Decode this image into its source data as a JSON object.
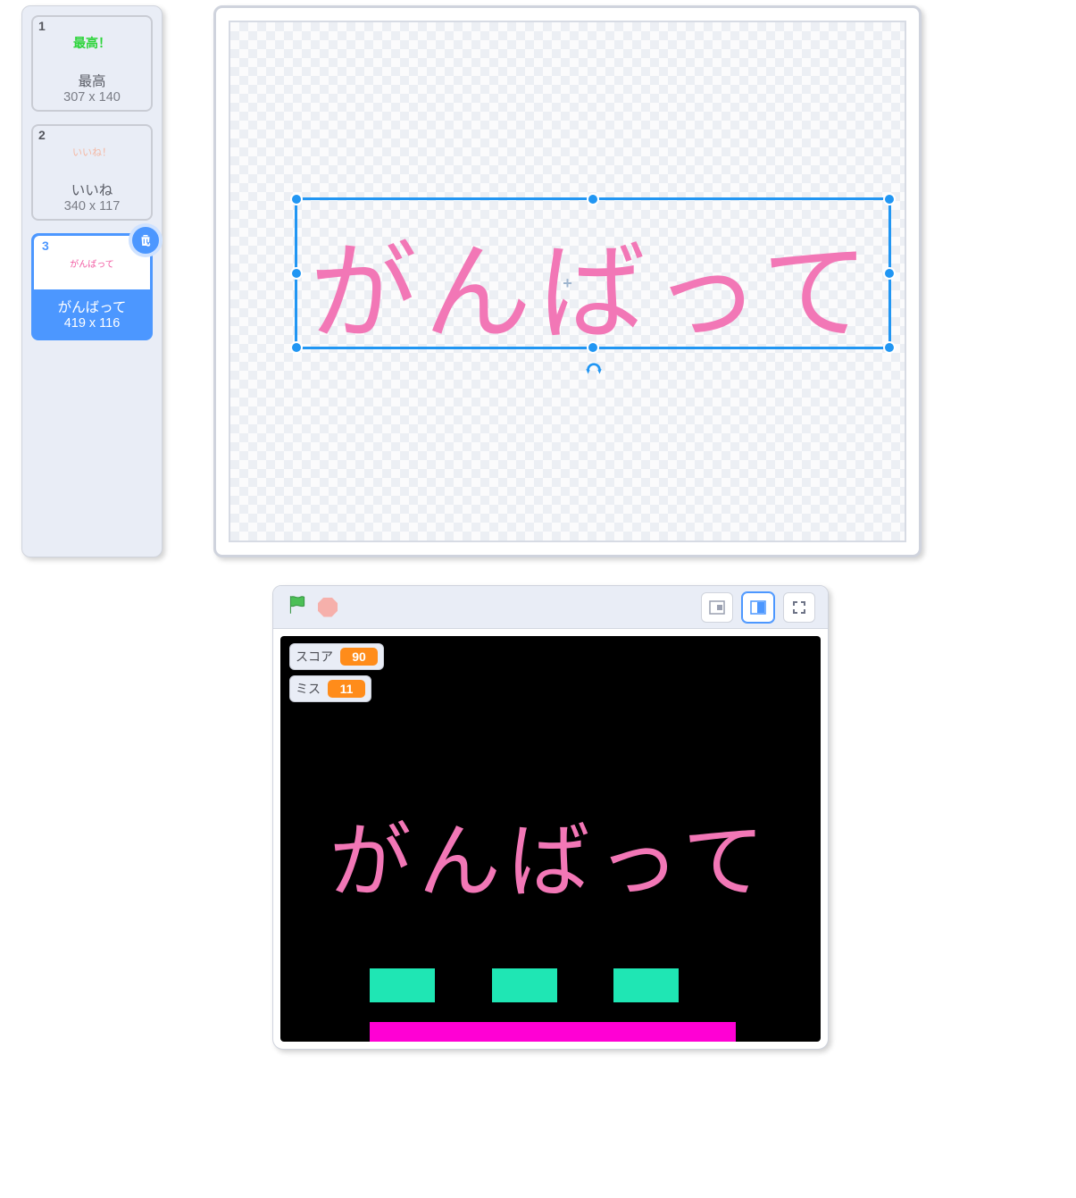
{
  "costume_panel": {
    "items": [
      {
        "index": "1",
        "thumb_text": "最高！",
        "thumb_color": "#2dd43b",
        "name": "最高",
        "dims": "307 x 140"
      },
      {
        "index": "2",
        "thumb_text": "いいね！",
        "thumb_color": "#f4b7a3",
        "name": "いいね",
        "dims": "340 x 117"
      },
      {
        "index": "3",
        "thumb_text": "がんばって",
        "thumb_color": "#f25aa2",
        "name": "がんばって",
        "dims": "419 x 116",
        "selected": true
      }
    ]
  },
  "paint_editor": {
    "text": "がんばって",
    "text_color": "#f277b6"
  },
  "stage": {
    "variables": [
      {
        "label": "スコア",
        "value": "90"
      },
      {
        "label": "ミス",
        "value": "11"
      }
    ],
    "text": "がんばって",
    "text_color": "#f277b6"
  },
  "colors": {
    "accent": "#4c97ff",
    "orange": "#ff8c1a",
    "turquoise": "#1fe6b4",
    "magenta": "#ff00d4"
  }
}
